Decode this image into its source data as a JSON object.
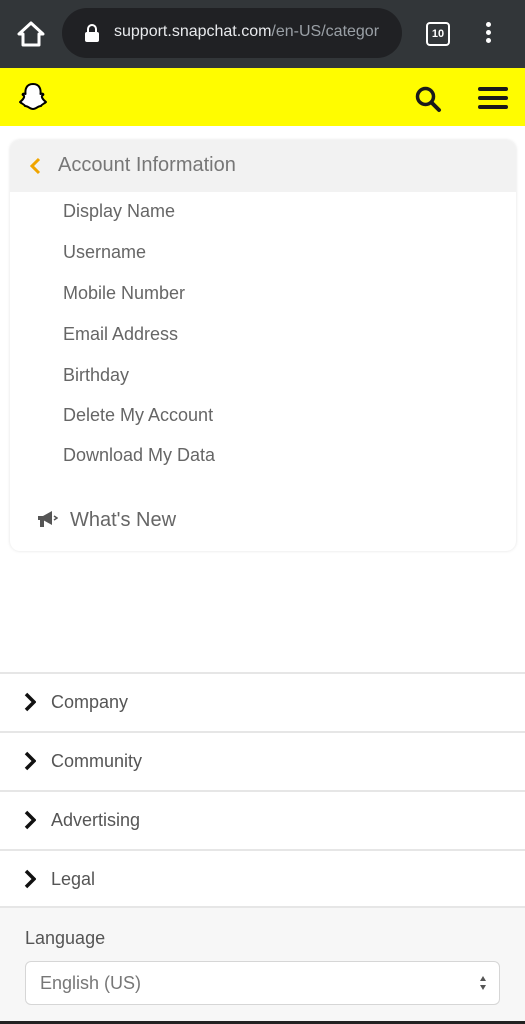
{
  "browser": {
    "url_host": "support.snapchat.com",
    "url_path": "/en-US/categor",
    "tab_count": "10"
  },
  "header": {
    "logo": "snapchat-ghost",
    "search_icon": "search-icon",
    "menu_icon": "hamburger-menu-icon",
    "brand_color": "#fffc00"
  },
  "card": {
    "title": "Account Information",
    "back_color": "#f0a500",
    "items": [
      {
        "label": "Display Name"
      },
      {
        "label": "Username"
      },
      {
        "label": "Mobile Number"
      },
      {
        "label": "Email Address"
      },
      {
        "label": "Birthday"
      },
      {
        "label": "Delete My Account"
      },
      {
        "label": "Download My Data"
      }
    ],
    "whats_new": "What's New"
  },
  "footer": {
    "items": [
      {
        "label": "Company"
      },
      {
        "label": "Community"
      },
      {
        "label": "Advertising"
      },
      {
        "label": "Legal"
      }
    ],
    "language_label": "Language",
    "language_value": "English (US)"
  }
}
